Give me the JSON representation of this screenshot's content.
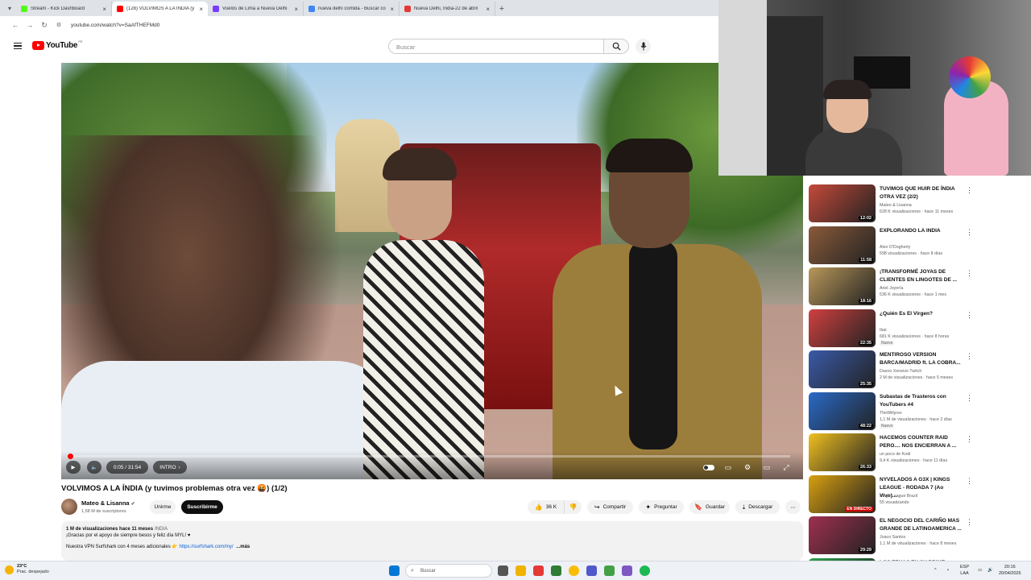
{
  "browser": {
    "tabs": [
      {
        "label": "Stream - Kick Dashboard",
        "color": "#53fc18",
        "active": false
      },
      {
        "label": "(128) VOLVIMOS A LA ÍNDIA (y",
        "color": "#ff0000",
        "active": true
      },
      {
        "label": "Vuelos de Lima a Nueva Delhi",
        "color": "#7a3cff",
        "active": false
      },
      {
        "label": "nueva delhi comida - Buscar co",
        "color": "#4285f4",
        "active": false
      },
      {
        "label": "Nueva Delhi, India-22 de abril",
        "color": "#e53935",
        "active": false
      }
    ],
    "url": "youtube.com/watch?v=SaAfTHEFMd0"
  },
  "header": {
    "logo_text": "YouTube",
    "country_code": "PE",
    "search_placeholder": "Buscar"
  },
  "player": {
    "time": "0:05 / 31:54",
    "chapter": "INTRO",
    "progress_fraction": 0.003
  },
  "video": {
    "title": "VOLVIMOS A LA ÍNDIA (y tuvimos problemas otra vez 🤬) (1/2)",
    "channel": "Mateo & Lisanna",
    "subscribers": "1,58 M de suscriptores",
    "join_label": "Unirme",
    "subscribe_label": "Suscribirme",
    "likes": "36 K",
    "share_label": "Compartir",
    "ask_label": "Preguntar",
    "save_label": "Guardar",
    "download_label": "Descargar",
    "description": {
      "views_time": "1 M de visualizaciones  hace 11 meses",
      "tag": "INDIA",
      "line1": "¡Gracias por el apoyo de siempre besos y feliz día MYL! ♥",
      "line2_prefix": "Nuestra VPN Surfshark con 4 meses adicionales 👉",
      "link": "https://surfshark.com/my/",
      "more": "...más"
    }
  },
  "sidebar": [
    {
      "title": "TUVIMOS QUE HUIR DE ÍNDIA OTRA VEZ (2/2)",
      "channel": "Mateo & Lisanna",
      "views": "628 K visualizaciones · hace 11 meses",
      "duration": "12:02",
      "badge": "",
      "thumb": "#c44a3a"
    },
    {
      "title": "EXPLORANDO LA INDIA",
      "channel": "Alex O'Dogherty",
      "views": "598 visualizaciones · hace 8 días",
      "duration": "11:58",
      "badge": "",
      "thumb": "#8a5a3a"
    },
    {
      "title": "¡TRANSFORMÉ JOYAS DE CLIENTES EN LINGOTES DE ...",
      "channel": "Ariel Joyería",
      "views": "536 K visualizaciones · hace 1 mes",
      "duration": "18:16",
      "badge": "",
      "thumb": "#b8975a"
    },
    {
      "title": "¿Quién Es El Virgen?",
      "channel": "Ibai",
      "views": "681 K visualizaciones · hace 8 horas",
      "duration": "22:35",
      "badge": "Nuevo",
      "thumb": "#d04040"
    },
    {
      "title": "MENTIROSO VERSION BARCA/MADRID ft. LA COBRA...",
      "channel": "Davoo Xeneize Twitch",
      "views": "2 M de visualizaciones · hace 5 meses",
      "duration": "25:35",
      "badge": "",
      "thumb": "#3a5aa8"
    },
    {
      "title": "Subastas de Trasteros con YouTubers #4",
      "channel": "TheWillyrex",
      "views": "1,1 M de visualizaciones · hace 2 días",
      "duration": "48:22",
      "badge": "Nuevo",
      "thumb": "#2a6ac8"
    },
    {
      "title": "HACEMOS COUNTER RAID PERO.... NOS ENCIERRAN A ...",
      "channel": "un poco de Kodi",
      "views": "9,4 K visualizaciones · hace 11 días",
      "duration": "26:33",
      "badge": "",
      "thumb": "#f0c020"
    },
    {
      "title": "NYVELADOS A G3X | KINGS LEAGUE - RODADA 7 (Ao Vivo)...",
      "channel": "Kings League Brazil",
      "views": "55 visualizando",
      "duration": "EN DIRECTO",
      "badge": "",
      "thumb": "#d8a010"
    },
    {
      "title": "EL NEGOCIO DEL CARIÑO MAS GRANDE DE LATINOAMERICA ...",
      "channel": "Joaco Santos",
      "views": "1,1 M de visualizaciones · hace 8 meses",
      "duration": "29:29",
      "badge": "",
      "thumb": "#a03050"
    },
    {
      "title": "LOS FEKAS EN SU PRIME",
      "channel": "",
      "views": "",
      "duration": "",
      "badge": "",
      "thumb": "#30a050"
    }
  ],
  "taskbar": {
    "temp": "23°C",
    "weather": "Prac. despejado",
    "search": "Buscar",
    "lang1": "ESP",
    "lang2": "LAA",
    "time": "20:16",
    "date": "20/04/2026"
  }
}
